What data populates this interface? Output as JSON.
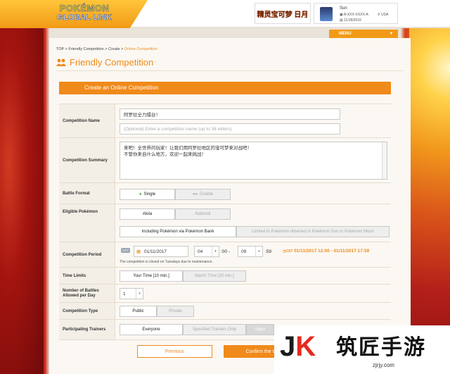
{
  "header": {
    "logo_top": "POKÉMON",
    "logo_bottom": "GLOBAL LINK",
    "game_badge": "精灵宝可梦 日月",
    "user": {
      "name": "Sun",
      "id": "A-XXX-XXXX-A",
      "country": "USA",
      "date": "11/18/2016"
    },
    "menu_label": "MENU",
    "menu_chevron": "▾"
  },
  "breadcrumb": {
    "items": [
      "TOP",
      "Friendly Competition",
      "Create"
    ],
    "separator": ">",
    "current": "Online Competition"
  },
  "page_title": "Friendly Competition",
  "section_title": "Create an Online Competition",
  "form": {
    "name": {
      "label": "Competition Name",
      "value": "阿罗拉全力擂台！",
      "placeholder": "(Optional) Enter a competition name (up to 36 letters)"
    },
    "summary": {
      "label": "Competition Summary",
      "line1": "来吧！全世界的玩家！让我们用阿罗拉地区的宝可梦来对战吧！",
      "line2": "不管你来自什么地方，欢迎一起来挑战！"
    },
    "battle_format": {
      "label": "Battle Format",
      "options": [
        "Single",
        "Double"
      ],
      "selected": "Single"
    },
    "eligible": {
      "label": "Eligible Pokémon",
      "options": [
        "Alola",
        "National"
      ],
      "bank_options": [
        "Including Pokémon via Pokémon Bank",
        "Limited to Pokémon obtained in Pokémon Sun or Pokémon Moon"
      ]
    },
    "period": {
      "label": "Competition Period",
      "utc": "UTC",
      "date": "01/11/2017",
      "hour": "04",
      "min_sep": ":00 -",
      "end_hour": "09",
      "end_min": ":59",
      "cst_label": "CST",
      "cst_range": "01/11/2017 12:00 - 01/11/2017 17:59",
      "note": "The competition is closed on Tuesdays due to maintenance."
    },
    "time_limits": {
      "label": "Time Limits",
      "options": [
        "Your Time [10 min.]",
        "Match Time [30 min.]"
      ]
    },
    "battles_per_day": {
      "label": "Number of Battles Allowed per Day",
      "value": "1"
    },
    "type": {
      "label": "Competition Type",
      "options": [
        "Public",
        "Private"
      ]
    },
    "trainers": {
      "label": "Participating Trainers",
      "options": [
        "Everyone",
        "Specified Trainers Only",
        "Speci"
      ]
    }
  },
  "buttons": {
    "previous": "Previous",
    "confirm": "Confirm the Co"
  },
  "watermark": {
    "mark_left": "J",
    "mark_right": "K",
    "text": "筑匠手游",
    "url": "zjrjy.com"
  },
  "colors": {
    "accent": "#f08a1a",
    "header_yellow": "#ffc53a"
  }
}
